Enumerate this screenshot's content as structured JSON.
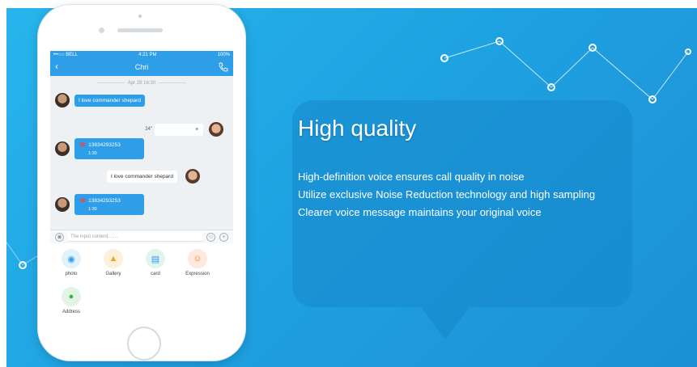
{
  "colors": {
    "accent": "#2e9ee8",
    "background": "#1fa3e2"
  },
  "status_bar": {
    "carrier": "•••○○ BELL",
    "time": "4:21 PM",
    "battery": "100%"
  },
  "chat": {
    "contact_name": "Chri",
    "date": "Apr 28  16:30",
    "messages": [
      {
        "text": "I love commander shepard"
      },
      {
        "duration": "24\""
      },
      {
        "number": "13834293253",
        "duration": "1:30"
      },
      {
        "text": "I love commander shepard"
      },
      {
        "number": "13834293253",
        "duration": "1:30"
      }
    ],
    "input_placeholder": "The input content……"
  },
  "tools": [
    {
      "label": "photo",
      "icon": "camera-icon"
    },
    {
      "label": "Gallery",
      "icon": "gallery-icon"
    },
    {
      "label": "card",
      "icon": "card-icon"
    },
    {
      "label": "Expression",
      "icon": "smiley-icon"
    },
    {
      "label": "Address",
      "icon": "location-pin-icon"
    }
  ],
  "promo": {
    "headline": "High quality",
    "features": [
      "High-definition voice ensures call quality in noise",
      "Utilize exclusive Noise Reduction technology and high sampling",
      "Clearer voice message maintains your original voice"
    ]
  }
}
